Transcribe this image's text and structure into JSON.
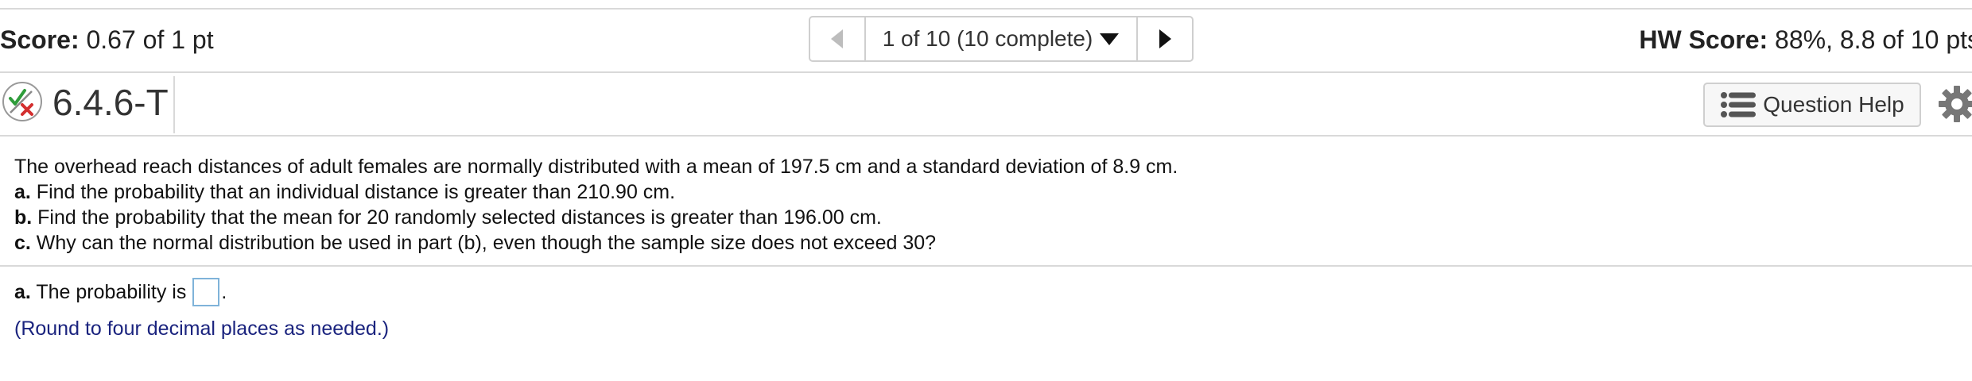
{
  "header": {
    "score_label": "Score:",
    "score_value": " 0.67 of 1 pt",
    "nav_label": "1 of 10 (10 complete)",
    "hw_score_label": "HW Score:",
    "hw_score_value": " 88%, 8.8 of 10 pts"
  },
  "question": {
    "id": "6.4.6-T",
    "help_label": "Question Help"
  },
  "problem": {
    "intro": "The overhead reach distances of adult females are normally distributed with a mean of 197.5 cm and a standard deviation of 8.9 cm.",
    "parts": [
      {
        "label": "a.",
        "text": " Find the probability that an individual distance is greater than 210.90 cm."
      },
      {
        "label": "b.",
        "text": " Find the probability that the mean for 20 randomly selected distances is greater than 196.00 cm."
      },
      {
        "label": "c.",
        "text": " Why can the normal distribution be used in part (b), even though the sample size does not exceed 30?"
      }
    ]
  },
  "answer": {
    "label": "a.",
    "text": " The probability is",
    "value": "",
    "period": ".",
    "hint": "(Round to four decimal places as needed.)"
  },
  "colors": {
    "check": "#2e9c3a",
    "cross": "#d32f2f",
    "hint": "#1a237e",
    "input_border": "#7fb3d9"
  },
  "icons": [
    "check-x-partial-icon",
    "prev-arrow-icon",
    "caret-down-icon",
    "next-arrow-icon",
    "list-icon",
    "gear-icon"
  ]
}
